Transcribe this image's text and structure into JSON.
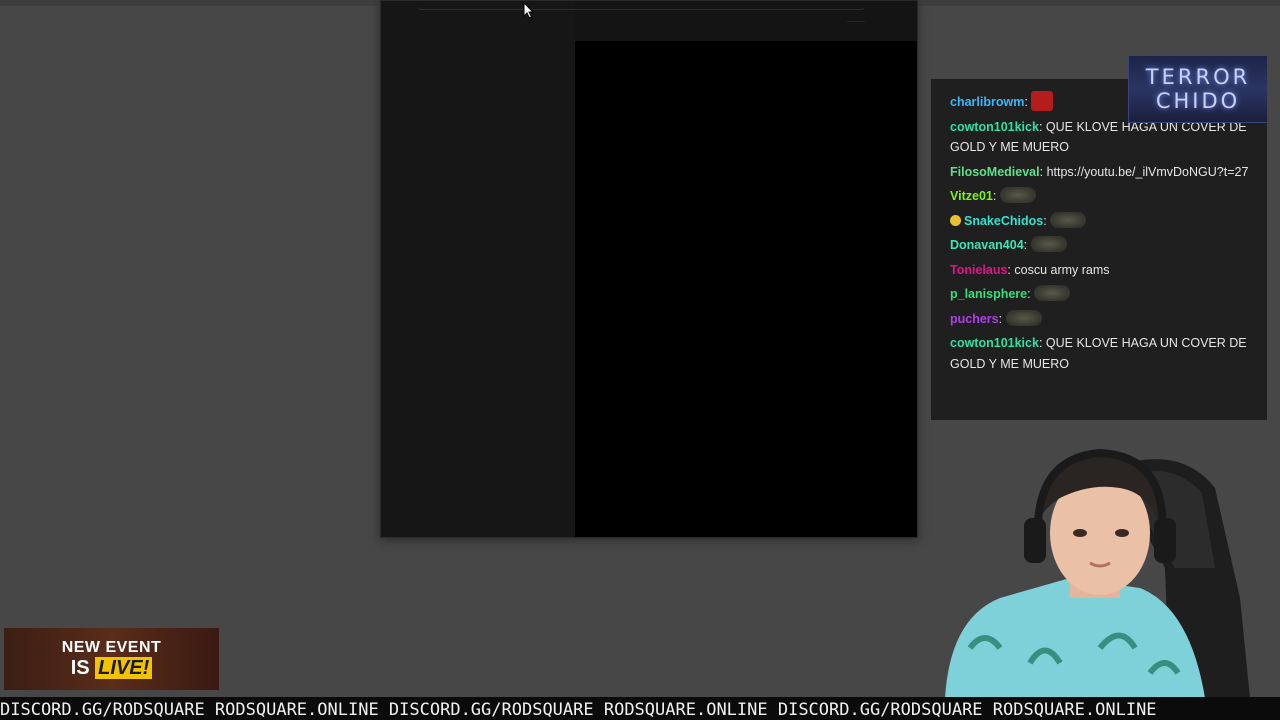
{
  "chat": {
    "messages": [
      {
        "user": "charlibrowm",
        "color": "#38b6ff",
        "text": "",
        "emote": "red-emote"
      },
      {
        "user": "cowton101kick",
        "color": "#2fe0a0",
        "text": "QUE KLOVE HAGA UN COVER DE GOLD Y ME MUERO"
      },
      {
        "user": "FilosoMedieval",
        "color": "#5ee08a",
        "text": "https://youtu.be/_ilVmvDoNGU?t=27"
      },
      {
        "user": "Vitze01",
        "color": "#7cf21c",
        "text": "",
        "emote": "emote"
      },
      {
        "user": "SnakeChidos",
        "color": "#34e2d0",
        "text": "",
        "emote": "emote",
        "badge": "smile"
      },
      {
        "user": "Donavan404",
        "color": "#3fe3b4",
        "text": "",
        "emote": "emote"
      },
      {
        "user": "Tonielaus",
        "color": "#e0148a",
        "text": "coscu army rams"
      },
      {
        "user": "p_lanisphere",
        "color": "#2fe07a",
        "text": "",
        "emote": "emote"
      },
      {
        "user": "puchers",
        "color": "#b23cf0",
        "text": "",
        "emote": "emote"
      },
      {
        "user": "cowton101kick",
        "color": "#2fe0a0",
        "text": "QUE KLOVE HAGA UN COVER DE GOLD Y ME MUERO"
      }
    ]
  },
  "logo": {
    "line1": "TERROR",
    "line2": "CHIDO"
  },
  "event_banner": {
    "line1": "NEW EVENT",
    "is": "IS",
    "live": "LIVE!"
  },
  "ticker": {
    "text": "DISCORD.GG/RODSQUARE RODSQUARE.ONLINE DISCORD.GG/RODSQUARE RODSQUARE.ONLINE DISCORD.GG/RODSQUARE RODSQUARE.ONLINE"
  }
}
